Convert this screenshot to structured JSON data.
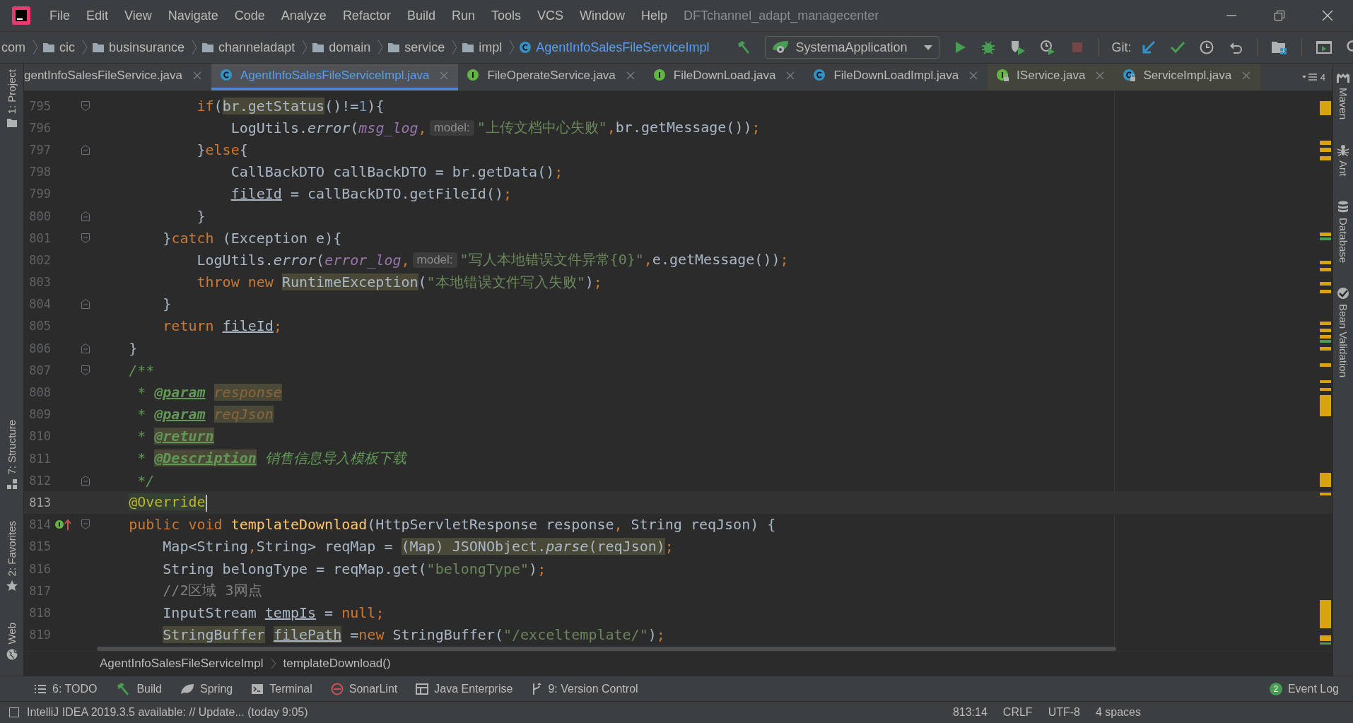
{
  "window": {
    "title": "DFTchannel_adapt_managecenter"
  },
  "menu": [
    {
      "label": "File"
    },
    {
      "label": "Edit"
    },
    {
      "label": "View"
    },
    {
      "label": "Navigate"
    },
    {
      "label": "Code"
    },
    {
      "label": "Analyze"
    },
    {
      "label": "Refactor"
    },
    {
      "label": "Build"
    },
    {
      "label": "Run"
    },
    {
      "label": "Tools"
    },
    {
      "label": "VCS"
    },
    {
      "label": "Window"
    },
    {
      "label": "Help"
    }
  ],
  "breadcrumb": [
    {
      "label": "com",
      "kind": "package"
    },
    {
      "label": "cic",
      "kind": "folder"
    },
    {
      "label": "businsurance",
      "kind": "folder"
    },
    {
      "label": "channeladapt",
      "kind": "folder"
    },
    {
      "label": "domain",
      "kind": "folder"
    },
    {
      "label": "service",
      "kind": "folder"
    },
    {
      "label": "impl",
      "kind": "folder"
    },
    {
      "label": "AgentInfoSalesFileServiceImpl",
      "kind": "class"
    }
  ],
  "run_config": {
    "value": "SystemaApplication"
  },
  "actions": [
    {
      "kind": "build",
      "disabled": false
    },
    {
      "kind": "run",
      "disabled": false
    },
    {
      "kind": "debug",
      "disabled": false
    },
    {
      "kind": "coverage",
      "disabled": false
    },
    {
      "kind": "profile",
      "disabled": false
    },
    {
      "kind": "stop",
      "disabled": true
    }
  ],
  "git_label": "Git:",
  "vcs_actions": [
    {
      "kind": "update"
    },
    {
      "kind": "commit"
    },
    {
      "kind": "history"
    },
    {
      "kind": "rollback"
    },
    {
      "kind": "project-structure"
    },
    {
      "kind": "console"
    },
    {
      "kind": "search"
    }
  ],
  "tabs": [
    {
      "label": "gentInfoSalesFileService.java",
      "kind": "none",
      "locked": false,
      "selected": false
    },
    {
      "label": "AgentInfoSalesFileServiceImpl.java",
      "kind": "class",
      "locked": false,
      "selected": true
    },
    {
      "label": "FileOperateService.java",
      "kind": "interface",
      "locked": false,
      "selected": false
    },
    {
      "label": "FileDownLoad.java",
      "kind": "interface",
      "locked": false,
      "selected": false
    },
    {
      "label": "FileDownLoadImpl.java",
      "kind": "class",
      "locked": false,
      "selected": false
    },
    {
      "label": "IService.java",
      "kind": "interface",
      "locked": true,
      "selected": false
    },
    {
      "label": "ServiceImpl.java",
      "kind": "class",
      "locked": true,
      "selected": false
    }
  ],
  "tab_overflow": {
    "count": "4"
  },
  "left_tools_top": [
    {
      "label": "1: Project",
      "kind": "project"
    }
  ],
  "left_tools_bottom": [
    {
      "label": "7: Structure",
      "kind": "structure"
    },
    {
      "label": "2: Favorites",
      "kind": "favorites"
    },
    {
      "label": "Web",
      "kind": "web"
    }
  ],
  "right_tools": [
    {
      "label": "Maven",
      "kind": "maven"
    },
    {
      "label": "Ant",
      "kind": "ant"
    },
    {
      "label": "Database",
      "kind": "database"
    },
    {
      "label": "Bean Validation",
      "kind": "bean"
    }
  ],
  "code": [
    {
      "children": [
        {
          "children": [
            {
              "number": "795",
              "fold_open": true,
              "fold_close": false,
              "current": false,
              "implemented": false,
              "tokens": [
                {
                  "text": "if",
                  "kind": "kw"
                },
                {
                  "text": "(",
                  "kind": "plain"
                },
                {
                  "text": "br.getStatus",
                  "kind": "plain",
                  "highlight": true
                },
                {
                  "text": "()!=",
                  "kind": "plain"
                },
                {
                  "text": "1",
                  "kind": "num"
                },
                {
                  "text": "){",
                  "kind": "plain"
                }
              ],
              "children": [
                {
                  "number": "796",
                  "fold_open": false,
                  "fold_close": false,
                  "current": false,
                  "implemented": false,
                  "tokens": [
                    {
                      "text": "LogUtils.",
                      "kind": "plain"
                    },
                    {
                      "text": "error",
                      "kind": "static"
                    },
                    {
                      "text": "(",
                      "kind": "plain"
                    },
                    {
                      "text": "msg_log",
                      "kind": "field"
                    },
                    {
                      "text": ",",
                      "kind": "punct"
                    },
                    {
                      "text": "model:",
                      "kind": "hint"
                    },
                    {
                      "text": "\"上传文档中心失败\"",
                      "kind": "str"
                    },
                    {
                      "text": ",",
                      "kind": "punct"
                    },
                    {
                      "text": "br.getMessage())",
                      "kind": "plain"
                    },
                    {
                      "text": ";",
                      "kind": "punct"
                    }
                  ]
                }
              ]
            },
            {
              "number": "797",
              "fold_open": false,
              "fold_close": true,
              "current": false,
              "implemented": false,
              "tokens": [
                {
                  "text": "}",
                  "kind": "plain"
                },
                {
                  "text": "else",
                  "kind": "kw"
                },
                {
                  "text": "{",
                  "kind": "plain"
                }
              ],
              "children": [
                {
                  "number": "798",
                  "fold_open": false,
                  "fold_close": false,
                  "current": false,
                  "implemented": false,
                  "tokens": [
                    {
                      "text": "CallBackDTO callBackDTO = br.getData()",
                      "kind": "plain"
                    },
                    {
                      "text": ";",
                      "kind": "punct"
                    }
                  ]
                },
                {
                  "number": "799",
                  "fold_open": false,
                  "fold_close": false,
                  "current": false,
                  "implemented": false,
                  "tokens": [
                    {
                      "text": "fileId",
                      "kind": "plain",
                      "underline": true
                    },
                    {
                      "text": " = callBackDTO.getFileId()",
                      "kind": "plain"
                    },
                    {
                      "text": ";",
                      "kind": "punct"
                    }
                  ]
                }
              ]
            },
            {
              "number": "800",
              "fold_open": false,
              "fold_close": true,
              "current": false,
              "implemented": false,
              "tokens": [
                {
                  "text": "}",
                  "kind": "plain"
                }
              ]
            }
          ]
        },
        {
          "number": "801",
          "fold_open": true,
          "fold_close": false,
          "current": false,
          "implemented": false,
          "tokens": [
            {
              "text": "}",
              "kind": "plain"
            },
            {
              "text": "catch",
              "kind": "kw"
            },
            {
              "text": " (Exception e){",
              "kind": "plain"
            }
          ],
          "children": [
            {
              "number": "802",
              "fold_open": false,
              "fold_close": false,
              "current": false,
              "implemented": false,
              "tokens": [
                {
                  "text": "LogUtils.",
                  "kind": "plain"
                },
                {
                  "text": "error",
                  "kind": "static"
                },
                {
                  "text": "(",
                  "kind": "plain"
                },
                {
                  "text": "error_log",
                  "kind": "field"
                },
                {
                  "text": ",",
                  "kind": "punct"
                },
                {
                  "text": "model:",
                  "kind": "hint"
                },
                {
                  "text": "\"写人本地错误文件异常{0}\"",
                  "kind": "str"
                },
                {
                  "text": ",",
                  "kind": "punct"
                },
                {
                  "text": "e.getMessage())",
                  "kind": "plain"
                },
                {
                  "text": ";",
                  "kind": "punct"
                }
              ]
            },
            {
              "number": "803",
              "fold_open": false,
              "fold_close": false,
              "current": false,
              "implemented": false,
              "tokens": [
                {
                  "text": "throw new ",
                  "kind": "kw"
                },
                {
                  "text": "RuntimeException",
                  "kind": "plain",
                  "highlight": true
                },
                {
                  "text": "(",
                  "kind": "plain"
                },
                {
                  "text": "\"本地错误文件写入失败\"",
                  "kind": "str"
                },
                {
                  "text": ")",
                  "kind": "plain"
                },
                {
                  "text": ";",
                  "kind": "punct"
                }
              ]
            }
          ]
        },
        {
          "number": "804",
          "fold_open": false,
          "fold_close": true,
          "current": false,
          "implemented": false,
          "tokens": [
            {
              "text": "}",
              "kind": "plain"
            }
          ]
        },
        {
          "number": "805",
          "fold_open": false,
          "fold_close": false,
          "current": false,
          "implemented": false,
          "tokens": [
            {
              "text": "return ",
              "kind": "kw"
            },
            {
              "text": "fileId",
              "kind": "plain",
              "underline": true
            },
            {
              "text": ";",
              "kind": "punct"
            }
          ]
        }
      ]
    },
    {
      "number": "806",
      "fold_open": false,
      "fold_close": true,
      "current": false,
      "implemented": false,
      "tokens": [
        {
          "text": "}",
          "kind": "plain"
        }
      ]
    },
    {
      "number": "807",
      "fold_open": true,
      "fold_close": false,
      "current": false,
      "implemented": false,
      "tokens": [
        {
          "text": "/**",
          "kind": "doc"
        }
      ]
    },
    {
      "number": "808",
      "fold_open": false,
      "fold_close": false,
      "current": false,
      "implemented": false,
      "tokens": [
        {
          "text": " * ",
          "kind": "doc"
        },
        {
          "text": "@param",
          "kind": "doctag"
        },
        {
          "text": " response",
          "kind": "docparam",
          "highlight": true
        }
      ]
    },
    {
      "number": "809",
      "fold_open": false,
      "fold_close": false,
      "current": false,
      "implemented": false,
      "tokens": [
        {
          "text": " * ",
          "kind": "doc"
        },
        {
          "text": "@param",
          "kind": "doctag"
        },
        {
          "text": " reqJson",
          "kind": "docparam",
          "highlight": true
        }
      ]
    },
    {
      "number": "810",
      "fold_open": false,
      "fold_close": false,
      "current": false,
      "implemented": false,
      "tokens": [
        {
          "text": " * ",
          "kind": "doc"
        },
        {
          "text": "@return",
          "kind": "doctag",
          "highlight": true
        }
      ]
    },
    {
      "number": "811",
      "fold_open": false,
      "fold_close": false,
      "current": false,
      "implemented": false,
      "tokens": [
        {
          "text": " * ",
          "kind": "doc"
        },
        {
          "text": "@Description",
          "kind": "doctag",
          "highlight": true
        },
        {
          "text": " 销售信息导入模板下载",
          "kind": "doc"
        }
      ]
    },
    {
      "number": "812",
      "fold_open": false,
      "fold_close": true,
      "current": false,
      "implemented": false,
      "tokens": [
        {
          "text": " */",
          "kind": "doc"
        }
      ]
    },
    {
      "number": "813",
      "fold_open": false,
      "fold_close": false,
      "current": true,
      "implemented": false,
      "tokens": [
        {
          "text": "@Override",
          "kind": "annot",
          "highlight": true
        }
      ]
    },
    {
      "number": "814",
      "fold_open": true,
      "fold_close": false,
      "current": false,
      "implemented": true,
      "tokens": [
        {
          "text": "public void ",
          "kind": "kw"
        },
        {
          "text": "templateDownload",
          "kind": "decl"
        },
        {
          "text": "(HttpServletResponse response",
          "kind": "plain"
        },
        {
          "text": ", ",
          "kind": "punct"
        },
        {
          "text": "String reqJson) {",
          "kind": "plain"
        }
      ],
      "children": [
        {
          "number": "815",
          "fold_open": false,
          "fold_close": false,
          "current": false,
          "implemented": false,
          "tokens": [
            {
              "text": "Map<String",
              "kind": "plain"
            },
            {
              "text": ",",
              "kind": "punct"
            },
            {
              "text": "String> reqMap = ",
              "kind": "plain"
            },
            {
              "text": "(Map) JSONObject.",
              "kind": "plain",
              "highlight": true
            },
            {
              "text": "parse",
              "kind": "static",
              "highlight": true
            },
            {
              "text": "(reqJson)",
              "kind": "plain",
              "highlight": true
            },
            {
              "text": ";",
              "kind": "punct"
            }
          ]
        },
        {
          "number": "816",
          "fold_open": false,
          "fold_close": false,
          "current": false,
          "implemented": false,
          "tokens": [
            {
              "text": "String belongType = reqMap.get(",
              "kind": "plain"
            },
            {
              "text": "\"belongType\"",
              "kind": "str"
            },
            {
              "text": ")",
              "kind": "plain"
            },
            {
              "text": ";",
              "kind": "punct"
            }
          ]
        },
        {
          "number": "817",
          "fold_open": false,
          "fold_close": false,
          "current": false,
          "implemented": false,
          "tokens": [
            {
              "text": "//2区域 3网点",
              "kind": "comment"
            }
          ]
        },
        {
          "number": "818",
          "fold_open": false,
          "fold_close": false,
          "current": false,
          "implemented": false,
          "tokens": [
            {
              "text": "InputStream ",
              "kind": "plain"
            },
            {
              "text": "tempIs",
              "kind": "plain",
              "underline": true
            },
            {
              "text": " = ",
              "kind": "plain"
            },
            {
              "text": "null",
              "kind": "kw"
            },
            {
              "text": ";",
              "kind": "punct"
            }
          ]
        },
        {
          "number": "819",
          "fold_open": false,
          "fold_close": false,
          "current": false,
          "implemented": false,
          "tokens": [
            {
              "text": "StringBuffer",
              "kind": "plain",
              "highlight": true
            },
            {
              "text": " filePath",
              "kind": "plain",
              "highlight": true,
              "underline": true
            },
            {
              "text": " =",
              "kind": "plain"
            },
            {
              "text": "new",
              "kind": "kw"
            },
            {
              "text": " StringBuffer(",
              "kind": "plain"
            },
            {
              "text": "\"/exceltemplate/\"",
              "kind": "str"
            },
            {
              "text": ")",
              "kind": "plain"
            },
            {
              "text": ";",
              "kind": "punct"
            }
          ]
        }
      ]
    }
  ],
  "editor_breadcrumb": [
    {
      "label": "AgentInfoSalesFileServiceImpl"
    },
    {
      "label": "templateDownload()"
    }
  ],
  "tool_windows": [
    {
      "label": "6: TODO",
      "kind": "todo"
    },
    {
      "label": "Build",
      "kind": "build"
    },
    {
      "label": "Spring",
      "kind": "spring"
    },
    {
      "label": "Terminal",
      "kind": "terminal"
    },
    {
      "label": "SonarLint",
      "kind": "sonarlint"
    },
    {
      "label": "Java Enterprise",
      "kind": "javaee"
    },
    {
      "label": "9: Version Control",
      "kind": "vcs"
    }
  ],
  "event_log": {
    "badge": "2",
    "label": "Event Log"
  },
  "status_bar": {
    "message": "IntelliJ IDEA 2019.3.5 available: // Update... (today 9:05)",
    "items": [
      {
        "text": "813:14"
      },
      {
        "text": "CRLF"
      },
      {
        "text": "UTF-8"
      },
      {
        "text": "4 spaces"
      }
    ]
  }
}
